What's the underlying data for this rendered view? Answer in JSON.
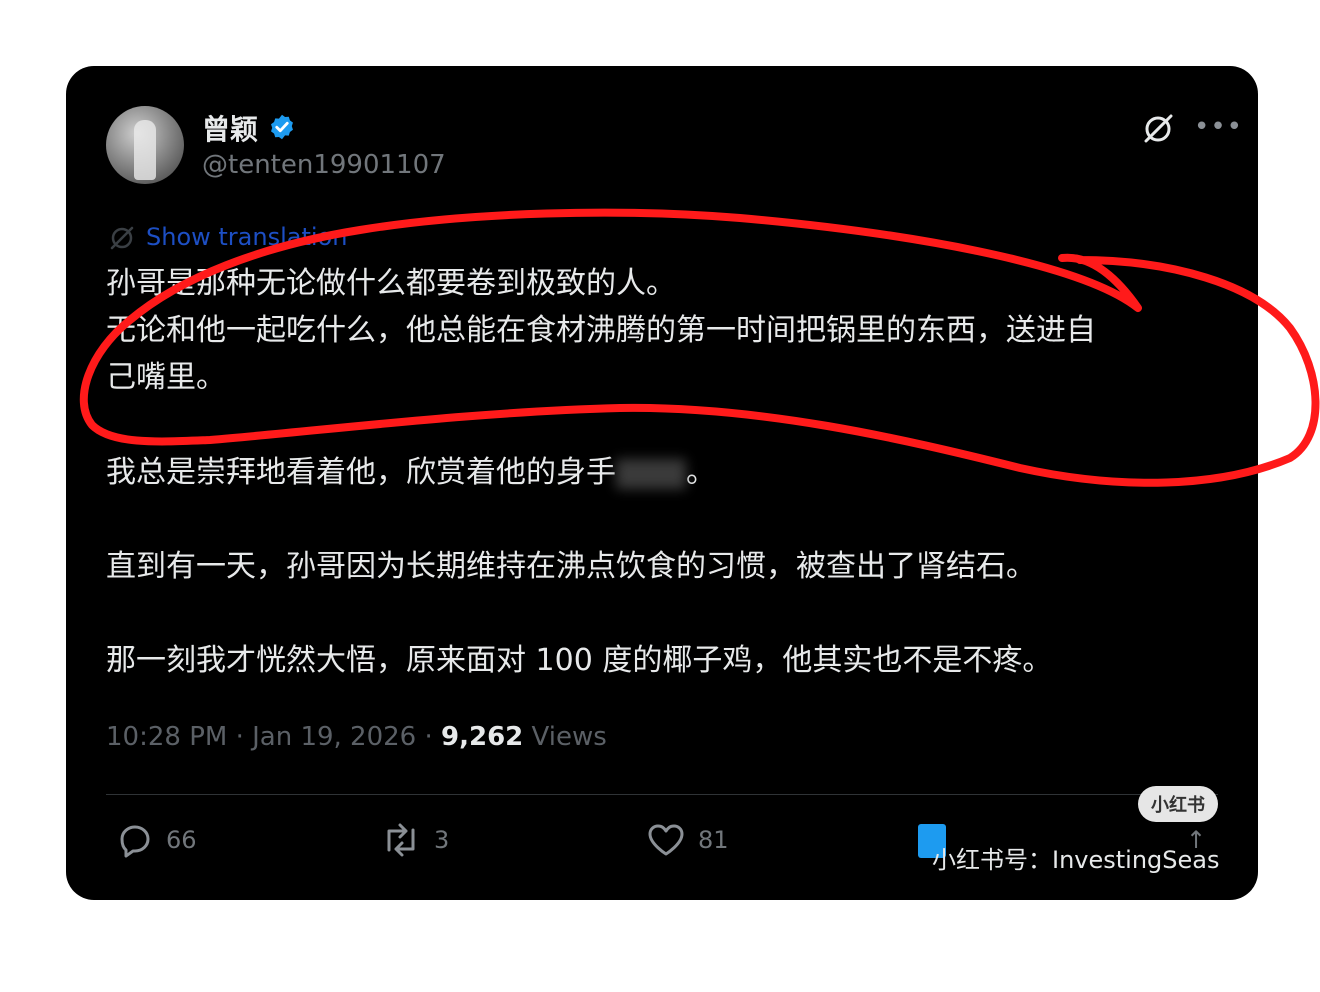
{
  "post": {
    "author_name": "曾颖",
    "handle": "@tenten19901107",
    "translate_label": "Show translation",
    "paragraphs": {
      "p1_l1": "孙哥是那种无论做什么都要卷到极致的人。",
      "p1_l2": "无论和他一起吃什么，他总能在食材沸腾的第一时间把锅里的东西，送进自",
      "p1_l3": "己嘴里。",
      "p2_before": "我总是崇拜地看着他，欣赏着他的身手",
      "p2_after": "。",
      "p3": "直到有一天，孙哥因为长期维持在沸点饮食的习惯，被查出了肾结石。",
      "p4": "那一刻我才恍然大悟，原来面对 100 度的椰子鸡，他其实也不是不疼。"
    },
    "meta": {
      "time_date": "10:28 PM · Jan 19, 2026 · ",
      "views_count": "9,262",
      "views_label": " Views"
    },
    "actions": {
      "replies": "66",
      "reposts": "3",
      "likes": "81"
    }
  },
  "watermark": {
    "badge": "小红书",
    "text": "小红书号：InvestingSeas"
  },
  "colors": {
    "background": "#000000",
    "text": "#e7e9ea",
    "muted": "#71767b",
    "link": "#1d4fc4",
    "verified": "#1d9bf0",
    "annotation": "#ff1a1a"
  },
  "icons": [
    "verified-badge-icon",
    "grok-icon",
    "more-icon",
    "translate-icon",
    "reply-icon",
    "repost-icon",
    "like-icon",
    "bookmark-icon",
    "share-icon"
  ]
}
